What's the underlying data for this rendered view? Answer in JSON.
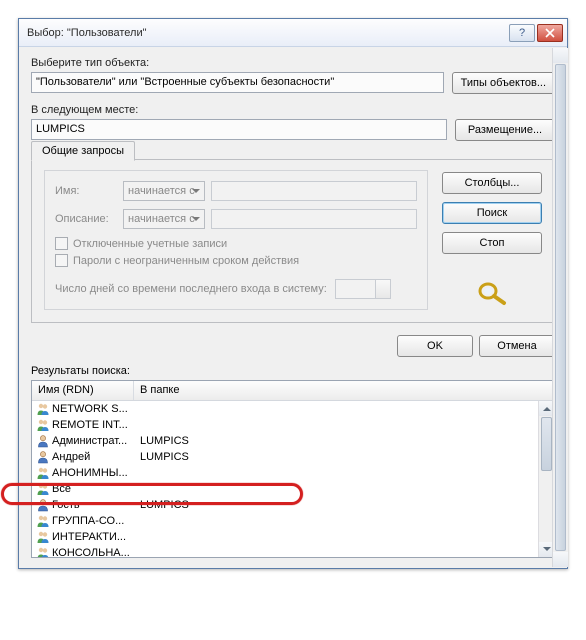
{
  "title": "Выбор: \"Пользователи\"",
  "object_type": {
    "label": "Выберите тип объекта:",
    "value": "\"Пользователи\" или \"Встроенные субъекты безопасности\"",
    "button": "Типы объектов..."
  },
  "location": {
    "label": "В следующем месте:",
    "value": "LUMPICS",
    "button": "Размещение..."
  },
  "queries": {
    "tab": "Общие запросы",
    "name_label": "Имя:",
    "desc_label": "Описание:",
    "match_mode": "начинается с",
    "disabled_accounts": "Отключенные учетные записи",
    "nonexpiring_pw": "Пароли с неограниченным сроком действия",
    "days_since_logon": "Число дней со времени последнего входа в систему:"
  },
  "side_buttons": {
    "columns": "Столбцы...",
    "search": "Поиск",
    "stop": "Стоп"
  },
  "ok": "OK",
  "cancel": "Отмена",
  "results": {
    "label": "Результаты поиска:",
    "col_name": "Имя (RDN)",
    "col_folder": "В папке",
    "rows": [
      {
        "name": "NETWORK S...",
        "folder": "",
        "icon": "group"
      },
      {
        "name": "REMOTE INT...",
        "folder": "",
        "icon": "group"
      },
      {
        "name": "Администрат...",
        "folder": "LUMPICS",
        "icon": "user"
      },
      {
        "name": "Андрей",
        "folder": "LUMPICS",
        "icon": "user"
      },
      {
        "name": "АНОНИМНЫ...",
        "folder": "",
        "icon": "group"
      },
      {
        "name": "Все",
        "folder": "",
        "icon": "group"
      },
      {
        "name": "Гость",
        "folder": "LUMPICS",
        "icon": "user"
      },
      {
        "name": "ГРУППА-СО...",
        "folder": "",
        "icon": "group"
      },
      {
        "name": "ИНТЕРАКТИ...",
        "folder": "",
        "icon": "group"
      },
      {
        "name": "КОНСОЛЬНА...",
        "folder": "",
        "icon": "group"
      }
    ]
  }
}
